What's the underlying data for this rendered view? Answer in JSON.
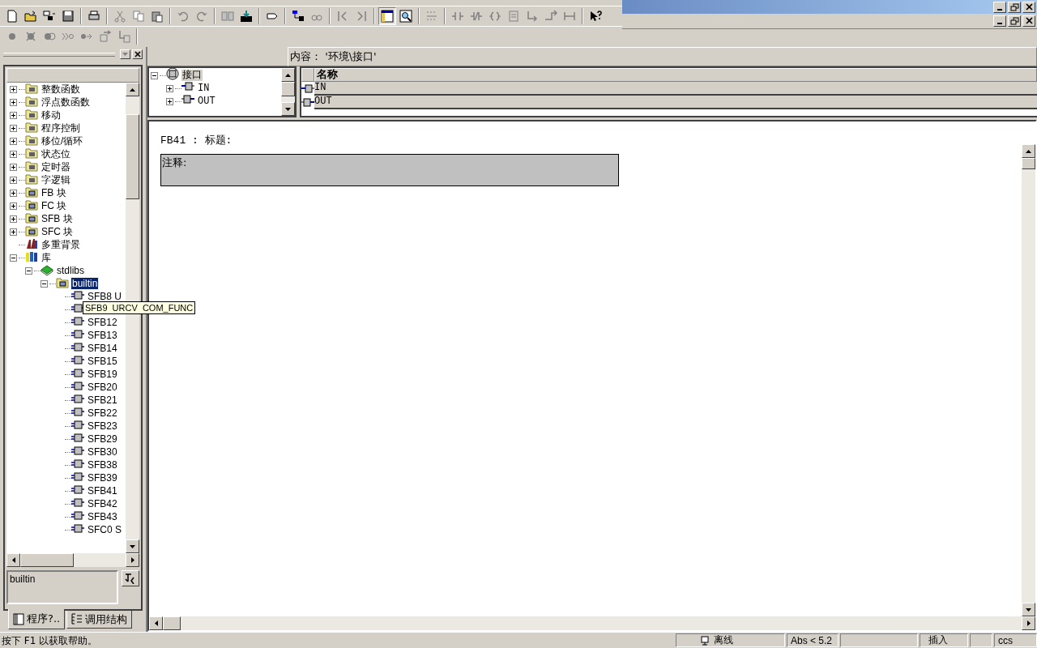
{
  "left_panel": {
    "tree": [
      {
        "label": "整数函数",
        "kind": "category",
        "expanded": false,
        "selected": false
      },
      {
        "label": "浮点数函数",
        "kind": "category",
        "expanded": false,
        "selected": false
      },
      {
        "label": "移动",
        "kind": "category",
        "expanded": false,
        "selected": false
      },
      {
        "label": "程序控制",
        "kind": "category",
        "expanded": false,
        "selected": false
      },
      {
        "label": "移位/循环",
        "kind": "category",
        "expanded": false,
        "selected": false
      },
      {
        "label": "状态位",
        "kind": "category",
        "expanded": false,
        "selected": false
      },
      {
        "label": "定时器",
        "kind": "category",
        "expanded": false,
        "selected": false
      },
      {
        "label": "字逻辑",
        "kind": "category",
        "expanded": false,
        "selected": false
      },
      {
        "label": "FB 块",
        "kind": "blockfolder",
        "expanded": false,
        "selected": false
      },
      {
        "label": "FC 块",
        "kind": "blockfolder",
        "expanded": false,
        "selected": false
      },
      {
        "label": "SFB 块",
        "kind": "blockfolder",
        "expanded": false,
        "selected": false
      },
      {
        "label": "SFC 块",
        "kind": "blockfolder",
        "expanded": false,
        "selected": false
      },
      {
        "label": "多重背景",
        "kind": "multi",
        "selected": false
      },
      {
        "label": "库",
        "kind": "library",
        "expanded": true,
        "selected": false,
        "children": [
          {
            "label": "stdlibs",
            "kind": "book",
            "expanded": true,
            "selected": false,
            "children": [
              {
                "label": "builtin",
                "kind": "blockfolder",
                "expanded": true,
                "selected": true,
                "children": [
                  {
                    "label": "SFB8 U",
                    "kind": "block",
                    "selected": false
                  },
                  {
                    "kind": "block",
                    "selected": false
                  },
                  {
                    "label": "SFB12",
                    "kind": "block",
                    "selected": false
                  },
                  {
                    "label": "SFB13",
                    "kind": "block",
                    "selected": false
                  },
                  {
                    "label": "SFB14",
                    "kind": "block",
                    "selected": false
                  },
                  {
                    "label": "SFB15",
                    "kind": "block",
                    "selected": false
                  },
                  {
                    "label": "SFB19",
                    "kind": "block",
                    "selected": false
                  },
                  {
                    "label": "SFB20",
                    "kind": "block",
                    "selected": false
                  },
                  {
                    "label": "SFB21",
                    "kind": "block",
                    "selected": false
                  },
                  {
                    "label": "SFB22",
                    "kind": "block",
                    "selected": false
                  },
                  {
                    "label": "SFB23",
                    "kind": "block",
                    "selected": false
                  },
                  {
                    "label": "SFB29",
                    "kind": "block",
                    "selected": false
                  },
                  {
                    "label": "SFB30",
                    "kind": "block",
                    "selected": false
                  },
                  {
                    "label": "SFB38",
                    "kind": "block",
                    "selected": false
                  },
                  {
                    "label": "SFB39",
                    "kind": "block",
                    "selected": false
                  },
                  {
                    "label": "SFB41",
                    "kind": "block",
                    "selected": false
                  },
                  {
                    "label": "SFB42",
                    "kind": "block",
                    "selected": false
                  },
                  {
                    "label": "SFB43",
                    "kind": "block",
                    "selected": false
                  },
                  {
                    "label": "SFC0 S",
                    "kind": "block",
                    "selected": false
                  }
                ]
              }
            ]
          }
        ]
      }
    ],
    "tooltip": "SFB9  URCV  COM_FUNC",
    "info_box": {
      "value": "builtin"
    },
    "tabs": [
      {
        "label": "程序?..",
        "selected": true
      },
      {
        "label": "调用结构",
        "selected": false
      }
    ]
  },
  "interface": {
    "header": "内容： '环境\\接口'",
    "tree": [
      {
        "label": "接口",
        "kind": "root",
        "expanded": true,
        "selected": true,
        "children": [
          {
            "label": "IN",
            "kind": "in",
            "expanded": false,
            "selected": false
          },
          {
            "label": "OUT",
            "kind": "out",
            "expanded": false,
            "selected": false
          }
        ]
      }
    ],
    "table": {
      "columns": [
        "名称"
      ],
      "rows": [
        {
          "kind": "in",
          "name": "IN"
        },
        {
          "kind": "out",
          "name": "OUT"
        }
      ]
    }
  },
  "editor": {
    "block_title": "FB41 : 标题:",
    "comment": "注释:"
  },
  "status_bar": {
    "help": "按下 F1 以获取帮助。",
    "panels": [
      {
        "kind": "connection",
        "text": "离线"
      },
      {
        "kind": "text",
        "text": "Abs < 5.2"
      },
      {
        "kind": "blank"
      },
      {
        "kind": "text",
        "text": "插入"
      },
      {
        "kind": "blank"
      },
      {
        "kind": "text",
        "text": "ccs"
      }
    ]
  }
}
